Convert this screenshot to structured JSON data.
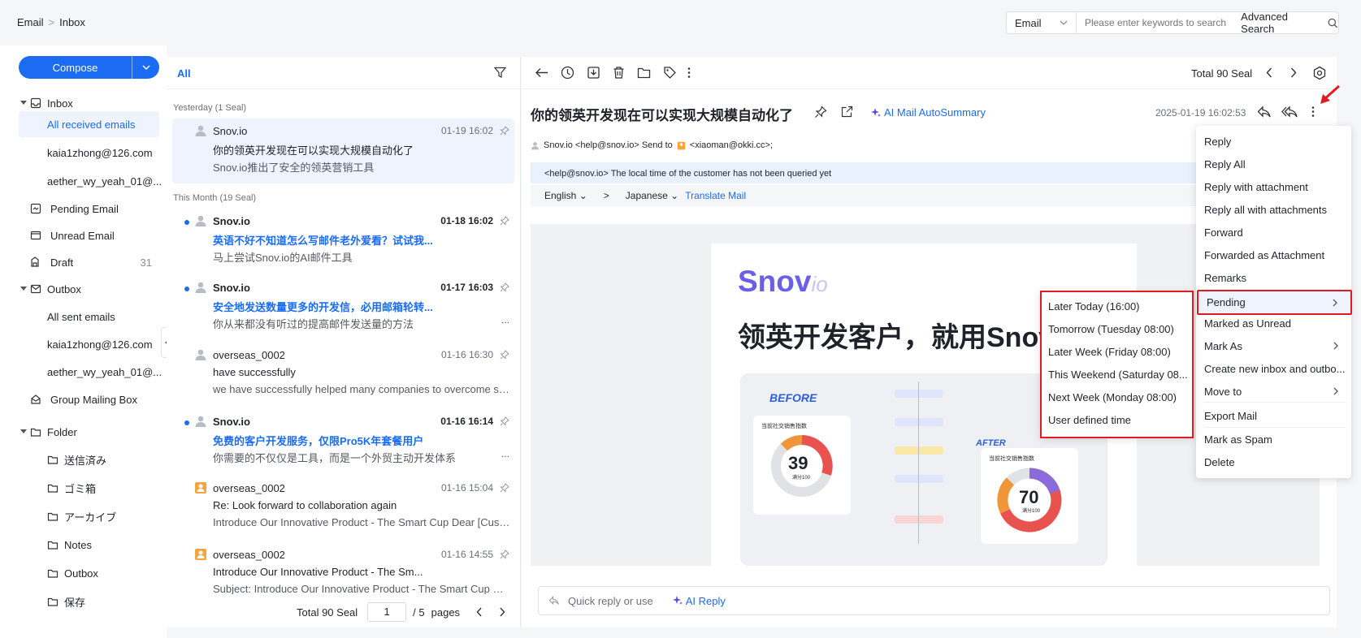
{
  "breadcrumb": {
    "root": "Email",
    "sep": ">",
    "current": "Inbox"
  },
  "search": {
    "type": "Email",
    "placeholder": "Please enter keywords to search",
    "advanced": "Advanced Search"
  },
  "compose": {
    "label": "Compose"
  },
  "sidebar": {
    "inbox": "Inbox",
    "all_received": "All received emails",
    "acct1": "kaia1zhong@126.com",
    "acct2": "aether_wy_yeah_01@...",
    "pending": "Pending Email",
    "unread": "Unread Email",
    "draft": "Draft",
    "draft_count": "31",
    "outbox": "Outbox",
    "all_sent": "All sent emails",
    "out_acct1": "kaia1zhong@126.com",
    "out_acct2": "aether_wy_yeah_01@...",
    "group": "Group Mailing Box",
    "folder": "Folder",
    "folders": [
      "送信済み",
      "ゴミ箱",
      "アーカイブ",
      "Notes",
      "Outbox",
      "保存"
    ]
  },
  "list": {
    "tab": "All",
    "group_yesterday": "Yesterday (1 Seal)",
    "group_month": "This Month (19 Seal)",
    "mails": [
      {
        "from": "Snov.io",
        "date": "01-19 16:02",
        "subject": "你的领英开发现在可以实现大规模自动化了",
        "preview": "Snov.io推出了安全的领英营销工具"
      },
      {
        "from": "Snov.io",
        "date": "01-18 16:02",
        "subject": "英语不好不知道怎么写邮件老外爱看？试试我...",
        "preview": "马上尝试Snov.io的AI邮件工具"
      },
      {
        "from": "Snov.io",
        "date": "01-17 16:03",
        "subject": "安全地发送数量更多的开发信，必用邮箱轮转...",
        "preview": "你从来都没有听过的提高邮件发送量的方法"
      },
      {
        "from": "overseas_0002",
        "date": "01-16 16:30",
        "subject": "have successfully",
        "preview": "we have successfully helped many companies to overcome simi..."
      },
      {
        "from": "Snov.io",
        "date": "01-16 16:14",
        "subject": "免费的客户开发服务，仅限Pro5K年套餐用户",
        "preview": "你需要的不仅仅是工具，而是一个外贸主动开发体系"
      },
      {
        "from": "overseas_0002",
        "date": "01-16 15:04",
        "subject": "Re: Look forward to collaboration again",
        "preview": "Introduce Our Innovative Product - The Smart Cup Dear [Custo..."
      },
      {
        "from": "overseas_0002",
        "date": "01-16 14:55",
        "subject": "Introduce Our Innovative Product - The Sm...",
        "preview": "Subject: Introduce Our Innovative Product - The Smart Cup De..."
      }
    ],
    "more": "...",
    "pager": {
      "total": "Total 90 Seal",
      "page": "1",
      "of": "/ 5",
      "pages": "pages"
    }
  },
  "reader": {
    "total": "Total 90 Seal",
    "title": "你的领英开发现在可以实现大规模自动化了",
    "ai_summary": "AI Mail AutoSummary",
    "date": "2025-01-19 16:02:53",
    "from_line": "Snov.io <help@snov.io> Send to",
    "to": "<xiaoman@okki.cc>;",
    "notice": "<help@snov.io> The local time of the customer has not been queried yet",
    "lang_from": "English",
    "lang_arrow": ">",
    "lang_to": "Japanese",
    "translate": "Translate Mail",
    "logo": "Snov",
    "logo_io": "io",
    "headline": "领英开发客户，就用Snov",
    "before": "BEFORE",
    "after": "AFTER",
    "score_label": "当前社交销售指数",
    "score1": "39",
    "score2": "70",
    "score_sub": "满分100",
    "quick_reply": "Quick reply or use",
    "ai_reply": "AI Reply"
  },
  "menu": {
    "items": [
      "Reply",
      "Reply All",
      "Reply with attachment",
      "Reply all with attachments",
      "Forward",
      "Forwarded as Attachment",
      "Remarks",
      "Pending",
      "Marked as Unread",
      "Mark As",
      "Create new inbox and outbo...",
      "Move to",
      "Export Mail",
      "Mark as Spam",
      "Delete"
    ]
  },
  "submenu": {
    "items": [
      "Later Today (16:00)",
      "Tomorrow (Tuesday 08:00)",
      "Later Week (Friday 08:00)",
      "This Weekend (Saturday 08...",
      "Next Week (Monday 08:00)",
      "User defined time"
    ]
  },
  "colors": {
    "accent": "#1b6cf2",
    "highlight": "#e11b22"
  }
}
